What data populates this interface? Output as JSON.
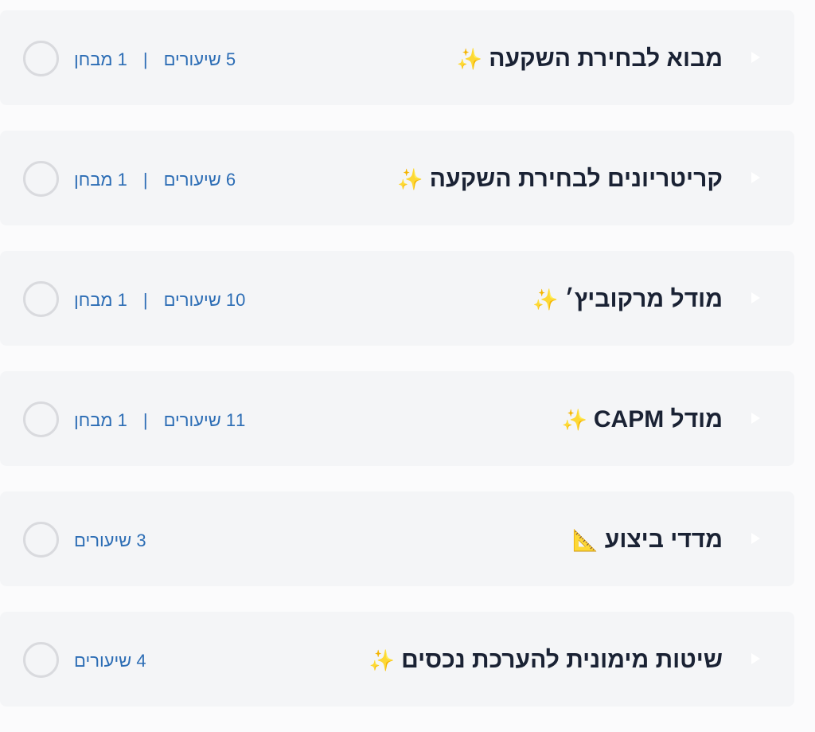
{
  "sections": [
    {
      "title": "מבוא לבחירת השקעה",
      "emoji": "✨",
      "lessons": "5 שיעורים",
      "separator": "|",
      "exam": "1 מבחן"
    },
    {
      "title": "קריטריונים לבחירת השקעה",
      "emoji": "✨",
      "lessons": "6 שיעורים",
      "separator": "|",
      "exam": "1 מבחן"
    },
    {
      "title": "מודל מרקוביץ׳",
      "emoji": "✨",
      "lessons": "10 שיעורים",
      "separator": "|",
      "exam": "1 מבחן"
    },
    {
      "title": "מודל CAPM",
      "emoji": "✨",
      "lessons": "11 שיעורים",
      "separator": "|",
      "exam": "1 מבחן"
    },
    {
      "title": "מדדי ביצוע",
      "emoji": "📐",
      "lessons": "3 שיעורים",
      "separator": "",
      "exam": ""
    },
    {
      "title": "שיטות מימונית להערכת נכסים",
      "emoji": "✨",
      "lessons": "4 שיעורים",
      "separator": "",
      "exam": ""
    }
  ],
  "icons": {
    "expand": "triangle-right-icon",
    "complete": "circle-check-icon"
  },
  "colors": {
    "card_background": "#f4f5f7",
    "title": "#1a2234",
    "meta": "#2c6db5",
    "check_border": "#d9dade",
    "arrow": "#ffffff"
  }
}
